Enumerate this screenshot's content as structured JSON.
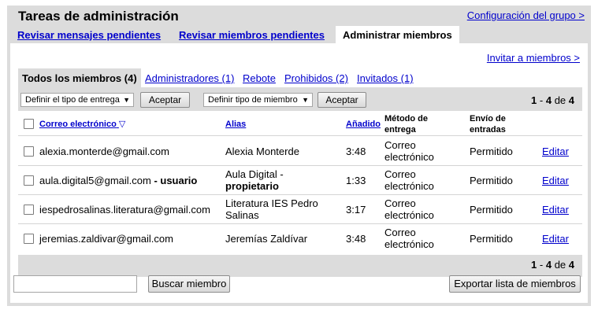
{
  "header": {
    "title": "Tareas de administración",
    "config_link": "Configuración del grupo >"
  },
  "topnav": {
    "tabs": [
      {
        "label": "Revisar mensajes pendientes"
      },
      {
        "label": "Revisar miembros pendientes"
      },
      {
        "label": "Administrar miembros"
      }
    ]
  },
  "invite_link": "Invitar a miembros >",
  "subtabs": [
    {
      "label": "Todos los miembros (4)"
    },
    {
      "label": "Administradores (1)"
    },
    {
      "label": "Rebote"
    },
    {
      "label": "Prohibidos (2)"
    },
    {
      "label": "Invitados (1)"
    }
  ],
  "toolbar": {
    "delivery_select": "Definir el tipo de entrega",
    "accept_1": "Aceptar",
    "member_select": "Definir tipo de miembro",
    "accept_2": "Aceptar",
    "pager": {
      "start": "1",
      "sep": " - ",
      "end": "4",
      "of": " de ",
      "total": "4"
    }
  },
  "table": {
    "headers": {
      "email": "Correo electrónico",
      "sort_icon": "▽",
      "alias": "Alias",
      "added": "Añadido",
      "delivery_1": "Método de",
      "delivery_2": "entrega",
      "posting_1": "Envío de",
      "posting_2": "entradas"
    },
    "rows": [
      {
        "email": "alexia.monterde@gmail.com",
        "role": "",
        "alias_1": "Alexia Monterde",
        "alias_2": "",
        "added": "3:48",
        "delivery_1": "Correo",
        "delivery_2": "electrónico",
        "posting": "Permitido",
        "edit": "Editar"
      },
      {
        "email": "aula.digital5@gmail.com",
        "role": " - usuario",
        "alias_1": "Aula Digital  -",
        "alias_2": "propietario",
        "added": "1:33",
        "delivery_1": "Correo",
        "delivery_2": "electrónico",
        "posting": "Permitido",
        "edit": "Editar"
      },
      {
        "email": "iespedrosalinas.literatura@gmail.com",
        "role": "",
        "alias_1": "Literatura IES Pedro",
        "alias_2": "Salinas",
        "added": "3:17",
        "delivery_1": "Correo",
        "delivery_2": "electrónico",
        "posting": "Permitido",
        "edit": "Editar"
      },
      {
        "email": "jeremias.zaldivar@gmail.com",
        "role": "",
        "alias_1": "Jeremías Zaldívar",
        "alias_2": "",
        "added": "3:48",
        "delivery_1": "Correo",
        "delivery_2": "electrónico",
        "posting": "Permitido",
        "edit": "Editar"
      }
    ]
  },
  "footer": {
    "search_placeholder": "",
    "search_button": "Buscar miembro",
    "export_button": "Exportar lista de miembros"
  }
}
